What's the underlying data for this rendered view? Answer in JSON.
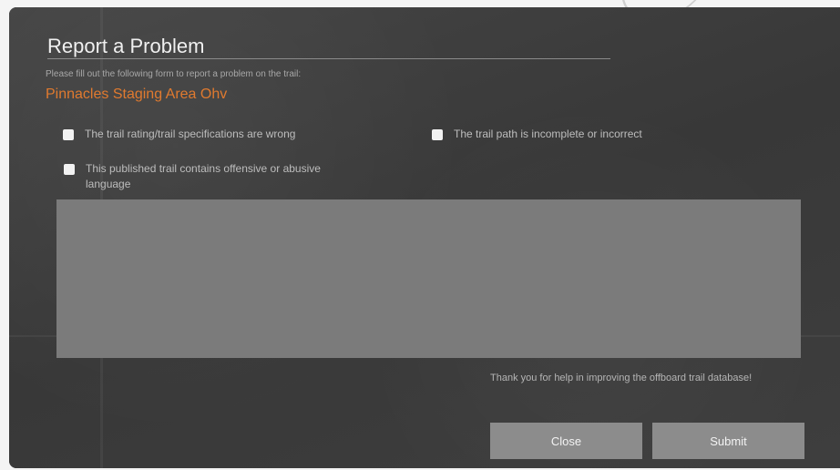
{
  "dialog": {
    "title": "Report a Problem",
    "subtitle": "Please fill out the following form to report a problem on the trail:",
    "trail_name": "Pinnacles Staging Area Ohv",
    "accent_color": "#e07a2f"
  },
  "options": [
    {
      "label": "The trail rating/trail specifications are wrong",
      "checked": false
    },
    {
      "label": "The trail path is incomplete or incorrect",
      "checked": false
    },
    {
      "label": "This published trail contains offensive or abusive language",
      "checked": false
    }
  ],
  "comment": {
    "value": "",
    "placeholder": ""
  },
  "footer": {
    "thanks_text": "Thank you for help in improving the offboard trail database!",
    "close_label": "Close",
    "submit_label": "Submit"
  }
}
